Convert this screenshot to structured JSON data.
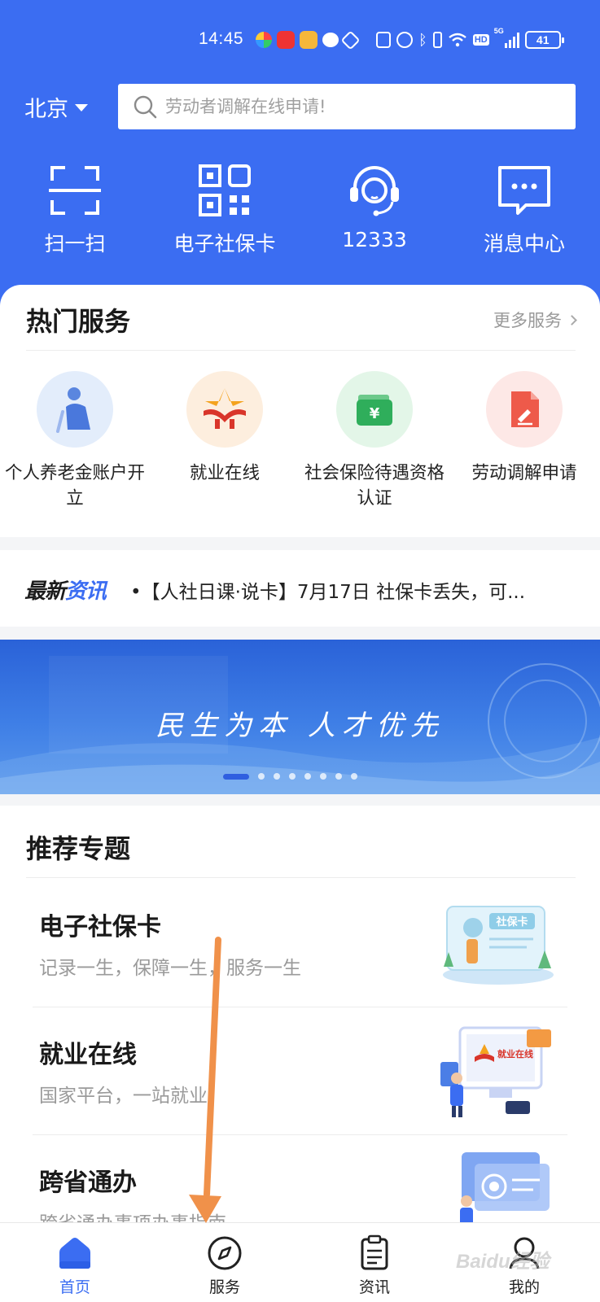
{
  "status_bar": {
    "time": "14:45",
    "network": "5G",
    "hd": "HD",
    "battery": "41"
  },
  "header": {
    "city": "北京",
    "search_placeholder": "劳动者调解在线申请!",
    "quick_actions": [
      {
        "label": "扫一扫",
        "icon": "scan-icon"
      },
      {
        "label": "电子社保卡",
        "icon": "qr-code-icon"
      },
      {
        "label": "12333",
        "icon": "headset-icon"
      },
      {
        "label": "消息中心",
        "icon": "message-icon"
      }
    ]
  },
  "hot_services": {
    "title": "热门服务",
    "more": "更多服务",
    "items": [
      {
        "label": "个人养老金账户开立",
        "icon": "elderly-icon",
        "bg": "#e3edfb"
      },
      {
        "label": "就业在线",
        "icon": "employment-logo-icon",
        "bg": "#fdeede"
      },
      {
        "label": "社会保险待遇资格认证",
        "icon": "wallet-icon",
        "bg": "#e3f6e8"
      },
      {
        "label": "劳动调解申请",
        "icon": "document-pen-icon",
        "bg": "#fde8e6"
      }
    ]
  },
  "news": {
    "tag_part1": "最新",
    "tag_part2": "资讯",
    "headline": "•【人社日课·说卡】7月17日 社保卡丢失，可..."
  },
  "banner": {
    "slogan": "民生为本 人才优先",
    "slide_count": 8,
    "active_slide": 0
  },
  "recommended": {
    "title": "推荐专题",
    "items": [
      {
        "title": "电子社保卡",
        "subtitle": "记录一生，保障一生，服务一生",
        "image": "social-security-card-illustration",
        "image_text": "社保卡"
      },
      {
        "title": "就业在线",
        "subtitle": "国家平台，一站就业",
        "image": "employment-platform-illustration",
        "image_text": "就业在线"
      },
      {
        "title": "跨省通办",
        "subtitle": "跨省通办事项办事指南",
        "image": "cross-province-illustration"
      }
    ]
  },
  "tabbar": {
    "tabs": [
      {
        "label": "首页",
        "icon": "home-icon",
        "active": true
      },
      {
        "label": "服务",
        "icon": "compass-icon",
        "active": false
      },
      {
        "label": "资讯",
        "icon": "news-icon",
        "active": false
      },
      {
        "label": "我的",
        "icon": "profile-icon",
        "active": false
      }
    ]
  },
  "watermark": "Baidu经验",
  "colors": {
    "primary": "#3b6df2",
    "annotation_arrow": "#f0914a"
  }
}
